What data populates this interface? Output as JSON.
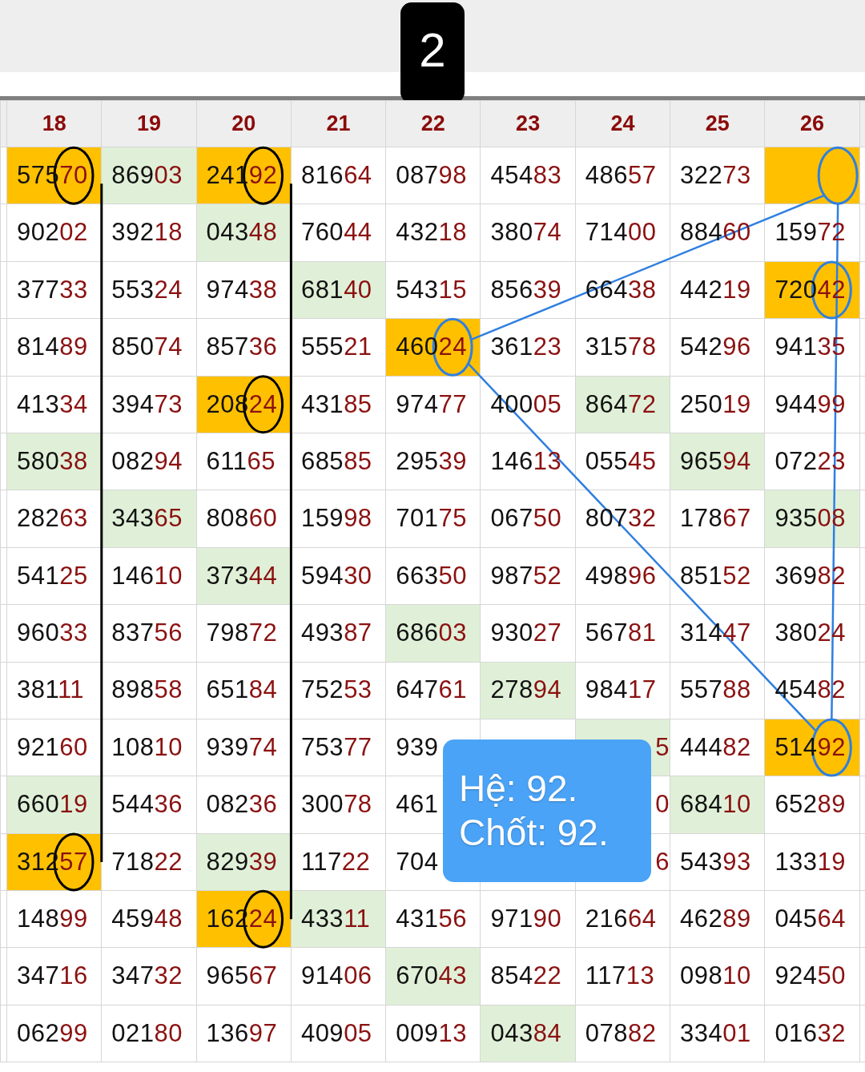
{
  "badge": "2",
  "columns": [
    "18",
    "19",
    "20",
    "21",
    "22",
    "23",
    "24",
    "25",
    "26"
  ],
  "rows": [
    [
      {
        "text": "57570",
        "color": "#ffc000",
        "ring": {
          "color": "#000000",
          "kind": "edge"
        }
      },
      {
        "text": "86903",
        "color": "#e0f0d8"
      },
      {
        "text": "24192",
        "color": "#ffc000",
        "ring": {
          "color": "#000000",
          "kind": "edge"
        }
      },
      {
        "text": "81664"
      },
      {
        "text": "08798"
      },
      {
        "text": "45483"
      },
      {
        "text": "48657"
      },
      {
        "text": "32273"
      },
      {
        "kind": "empty",
        "color": "#ffc000",
        "ring": {
          "color": "#2f7fe0",
          "kind": "center"
        }
      }
    ],
    [
      {
        "text": "90202"
      },
      {
        "text": "39218"
      },
      {
        "text": "04348",
        "color": "#e0f0d8"
      },
      {
        "text": "76044"
      },
      {
        "text": "43218"
      },
      {
        "text": "38074"
      },
      {
        "text": "71400"
      },
      {
        "text": "88460"
      },
      {
        "text": "15972"
      }
    ],
    [
      {
        "text": "37733"
      },
      {
        "text": "55324"
      },
      {
        "text": "97438"
      },
      {
        "text": "68140",
        "color": "#e0f0d8"
      },
      {
        "text": "54315"
      },
      {
        "text": "85639"
      },
      {
        "text": "66438"
      },
      {
        "text": "44219"
      },
      {
        "text": "72042",
        "color": "#ffc000",
        "ring": {
          "color": "#2f7fe0",
          "kind": "center"
        }
      }
    ],
    [
      {
        "text": "81489"
      },
      {
        "text": "85074"
      },
      {
        "text": "85736"
      },
      {
        "text": "55521"
      },
      {
        "text": "46024",
        "color": "#ffc000",
        "ring": {
          "color": "#2f7fe0",
          "kind": "center"
        }
      },
      {
        "text": "36123"
      },
      {
        "text": "31578"
      },
      {
        "text": "54296"
      },
      {
        "text": "94135"
      }
    ],
    [
      {
        "text": "41334"
      },
      {
        "text": "39473"
      },
      {
        "text": "20824",
        "color": "#ffc000",
        "ring": {
          "color": "#000000",
          "kind": "edge"
        }
      },
      {
        "text": "43185"
      },
      {
        "text": "97477"
      },
      {
        "text": "40005"
      },
      {
        "text": "86472",
        "color": "#e0f0d8"
      },
      {
        "text": "25019"
      },
      {
        "text": "94499"
      }
    ],
    [
      {
        "text": "58038",
        "color": "#e0f0d8"
      },
      {
        "text": "08294"
      },
      {
        "text": "61165"
      },
      {
        "text": "68585"
      },
      {
        "text": "29539"
      },
      {
        "text": "14613"
      },
      {
        "text": "05545"
      },
      {
        "text": "96594",
        "color": "#e0f0d8"
      },
      {
        "text": "07223"
      }
    ],
    [
      {
        "text": "28263"
      },
      {
        "text": "34365",
        "color": "#e0f0d8"
      },
      {
        "text": "80860"
      },
      {
        "text": "15998"
      },
      {
        "text": "70175"
      },
      {
        "text": "06750"
      },
      {
        "text": "80732"
      },
      {
        "text": "17867"
      },
      {
        "text": "93508",
        "color": "#e0f0d8"
      }
    ],
    [
      {
        "text": "54125"
      },
      {
        "text": "14610"
      },
      {
        "text": "37344",
        "color": "#e0f0d8"
      },
      {
        "text": "59430"
      },
      {
        "text": "66350"
      },
      {
        "text": "98752"
      },
      {
        "text": "49896"
      },
      {
        "text": "85152"
      },
      {
        "text": "36982"
      }
    ],
    [
      {
        "text": "96033"
      },
      {
        "text": "83756"
      },
      {
        "text": "79872"
      },
      {
        "text": "49387"
      },
      {
        "text": "68603",
        "color": "#e0f0d8"
      },
      {
        "text": "93027"
      },
      {
        "text": "56781"
      },
      {
        "text": "31447"
      },
      {
        "text": "38024"
      }
    ],
    [
      {
        "text": "38111"
      },
      {
        "text": "89858"
      },
      {
        "text": "65184"
      },
      {
        "text": "75253"
      },
      {
        "text": "64761"
      },
      {
        "text": "27894",
        "color": "#e0f0d8"
      },
      {
        "text": "98417"
      },
      {
        "text": "55788"
      },
      {
        "text": "45482"
      }
    ],
    [
      {
        "text": "92160"
      },
      {
        "text": "10810"
      },
      {
        "text": "93974"
      },
      {
        "text": "75377"
      },
      {
        "kind": "head",
        "text": "939"
      },
      {
        "kind": "empty"
      },
      {
        "kind": "tail",
        "text": "5",
        "color": "#e0f0d8"
      },
      {
        "text": "44482"
      },
      {
        "text": "51492",
        "color": "#ffc000",
        "ring": {
          "color": "#2f7fe0",
          "kind": "center"
        }
      }
    ],
    [
      {
        "text": "66019",
        "color": "#e0f0d8"
      },
      {
        "text": "54436"
      },
      {
        "text": "08236"
      },
      {
        "text": "30078"
      },
      {
        "kind": "head",
        "text": "461"
      },
      {
        "kind": "empty"
      },
      {
        "kind": "tail",
        "text": "0"
      },
      {
        "text": "68410",
        "color": "#e0f0d8"
      },
      {
        "text": "65289"
      }
    ],
    [
      {
        "text": "31257",
        "color": "#ffc000",
        "ring": {
          "color": "#000000",
          "kind": "edge"
        }
      },
      {
        "text": "71822"
      },
      {
        "text": "82939",
        "color": "#e0f0d8"
      },
      {
        "text": "11722"
      },
      {
        "kind": "head",
        "text": "704"
      },
      {
        "kind": "empty"
      },
      {
        "kind": "tail",
        "text": "6"
      },
      {
        "text": "54393"
      },
      {
        "text": "13319"
      }
    ],
    [
      {
        "text": "14899"
      },
      {
        "text": "45948"
      },
      {
        "text": "16224",
        "color": "#ffc000",
        "ring": {
          "color": "#000000",
          "kind": "edge"
        }
      },
      {
        "text": "43311",
        "color": "#e0f0d8"
      },
      {
        "text": "43156"
      },
      {
        "text": "97190"
      },
      {
        "text": "21664"
      },
      {
        "text": "46289"
      },
      {
        "text": "04564"
      }
    ],
    [
      {
        "text": "34716"
      },
      {
        "text": "34732"
      },
      {
        "text": "96567"
      },
      {
        "text": "91406"
      },
      {
        "text": "67043",
        "color": "#e0f0d8"
      },
      {
        "text": "85422"
      },
      {
        "text": "11713"
      },
      {
        "text": "09810"
      },
      {
        "text": "92450"
      }
    ],
    [
      {
        "text": "06299"
      },
      {
        "text": "02180"
      },
      {
        "text": "13697"
      },
      {
        "text": "40905"
      },
      {
        "text": "00913"
      },
      {
        "text": "04384",
        "color": "#e0f0d8"
      },
      {
        "text": "07882"
      },
      {
        "text": "33401"
      },
      {
        "text": "01632"
      }
    ]
  ],
  "popup": {
    "lines": [
      "Hệ: 92.",
      "Chốt: 92."
    ]
  }
}
